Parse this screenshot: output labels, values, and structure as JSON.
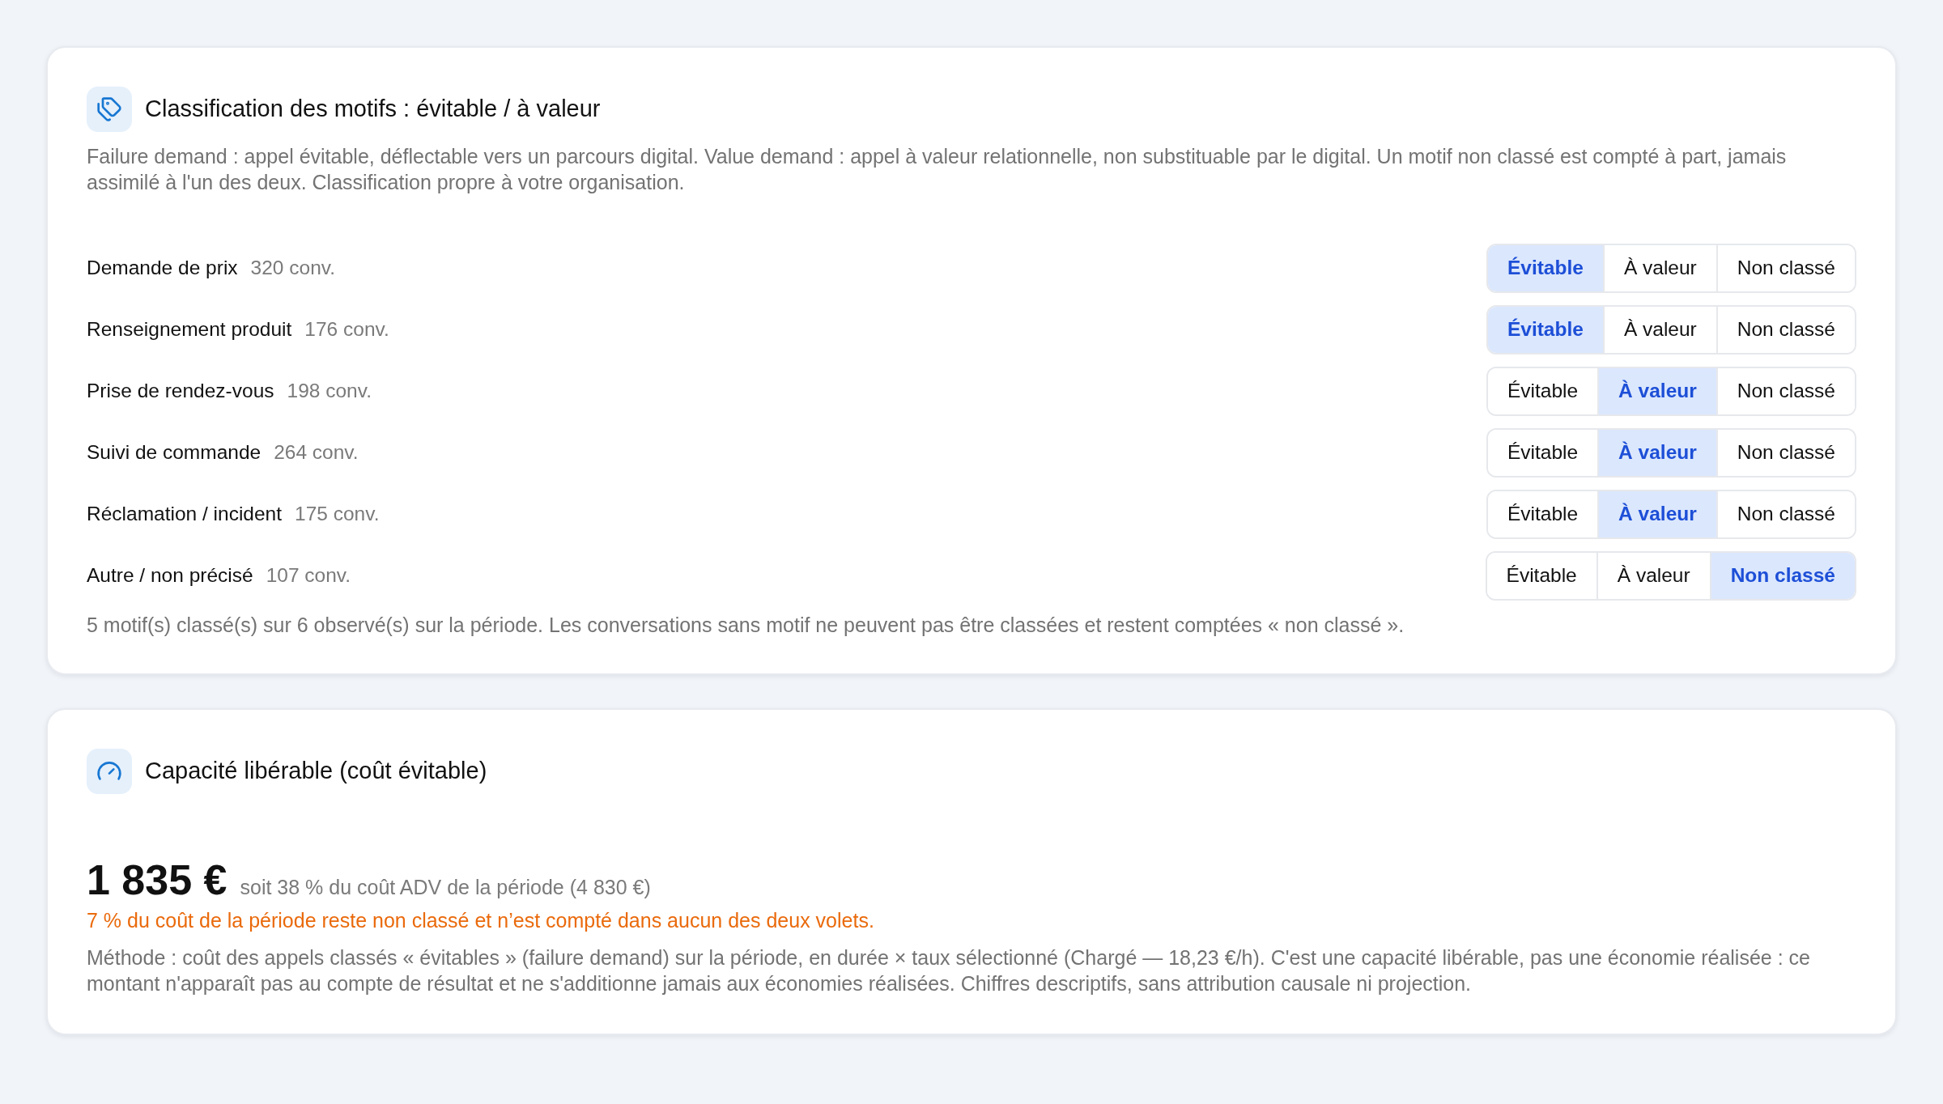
{
  "classification_card": {
    "title": "Classification des motifs : évitable / à valeur",
    "description": "Failure demand : appel évitable, déflectable vers un parcours digital. Value demand : appel à valeur relationnelle, non substituable par le digital. Un motif non classé est compté à part, jamais assimilé à l'un des deux. Classification propre à votre organisation.",
    "rows": [
      {
        "label": "Demande de prix",
        "count": "320 conv.",
        "choices": [
          {
            "label": "Évitable",
            "selected": true
          },
          {
            "label": "À valeur",
            "selected": false
          },
          {
            "label": "Non classé",
            "selected": false
          }
        ]
      },
      {
        "label": "Renseignement produit",
        "count": "176 conv.",
        "choices": [
          {
            "label": "Évitable",
            "selected": true
          },
          {
            "label": "À valeur",
            "selected": false
          },
          {
            "label": "Non classé",
            "selected": false
          }
        ]
      },
      {
        "label": "Prise de rendez-vous",
        "count": "198 conv.",
        "choices": [
          {
            "label": "Évitable",
            "selected": false
          },
          {
            "label": "À valeur",
            "selected": true
          },
          {
            "label": "Non classé",
            "selected": false
          }
        ]
      },
      {
        "label": "Suivi de commande",
        "count": "264 conv.",
        "choices": [
          {
            "label": "Évitable",
            "selected": false
          },
          {
            "label": "À valeur",
            "selected": true
          },
          {
            "label": "Non classé",
            "selected": false
          }
        ]
      },
      {
        "label": "Réclamation / incident",
        "count": "175 conv.",
        "choices": [
          {
            "label": "Évitable",
            "selected": false
          },
          {
            "label": "À valeur",
            "selected": true
          },
          {
            "label": "Non classé",
            "selected": false
          }
        ]
      },
      {
        "label": "Autre / non précisé",
        "count": "107 conv.",
        "choices": [
          {
            "label": "Évitable",
            "selected": false
          },
          {
            "label": "À valeur",
            "selected": false
          },
          {
            "label": "Non classé",
            "selected": true
          }
        ]
      }
    ],
    "summary": "5 motif(s) classé(s) sur 6 observé(s) sur la période. Les conversations sans motif ne peuvent pas être classées et restent comptées « non classé »."
  },
  "capacity_card": {
    "title": "Capacité libérable (coût évitable)",
    "amount": "1 835 €",
    "amount_note": "soit 38 % du coût ADV de la période (4 830 €)",
    "warning": "7 % du coût de la période reste non classé et n’est compté dans aucun des deux volets.",
    "method": "Méthode : coût des appels classés « évitables » (failure demand) sur la période, en durée × taux sélectionné (Chargé — 18,23 €/h). C'est une capacité libérable, pas une économie réalisée : ce montant n'apparaît pas au compte de résultat et ne s'additionne jamais aux économies réalisées. Chiffres descriptifs, sans attribution causale ni projection."
  }
}
